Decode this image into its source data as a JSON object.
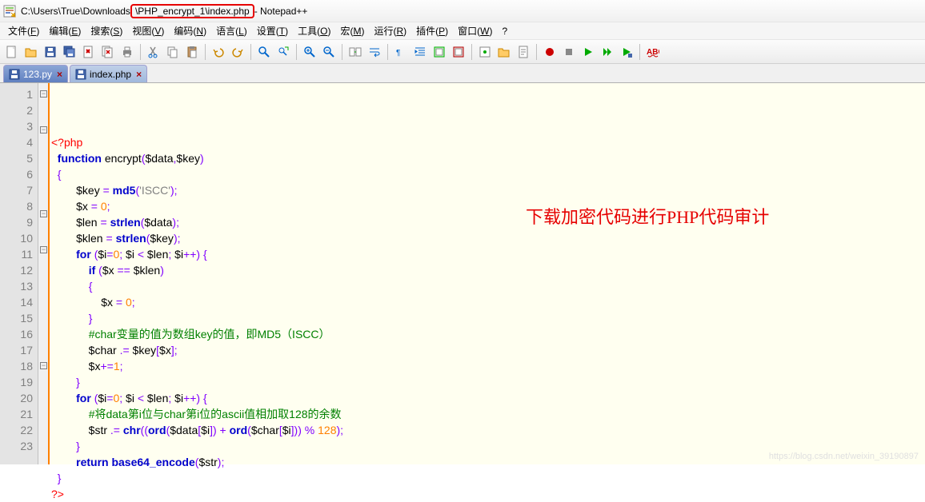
{
  "title": {
    "prefix": "C:\\Users\\True\\Downloads",
    "highlighted": "\\PHP_encrypt_1\\index.php",
    "suffix": " - Notepad++"
  },
  "menu": {
    "items": [
      "文件(F)",
      "编辑(E)",
      "搜索(S)",
      "视图(V)",
      "编码(N)",
      "语言(L)",
      "设置(T)",
      "工具(O)",
      "宏(M)",
      "运行(R)",
      "插件(P)",
      "窗口(W)",
      "?"
    ]
  },
  "tabs": {
    "items": [
      {
        "label": "123.py",
        "active": false
      },
      {
        "label": "index.php",
        "active": true
      }
    ]
  },
  "gutter": {
    "lines": [
      "1",
      "2",
      "3",
      "4",
      "5",
      "6",
      "7",
      "8",
      "9",
      "10",
      "11",
      "12",
      "13",
      "14",
      "15",
      "16",
      "17",
      "18",
      "19",
      "20",
      "21",
      "22",
      "23"
    ]
  },
  "code": {
    "lines": [
      [
        {
          "t": "<?php",
          "c": "tag"
        }
      ],
      [
        {
          "t": "  "
        },
        {
          "t": "function",
          "c": "kw"
        },
        {
          "t": " encrypt"
        },
        {
          "t": "(",
          "c": "pn"
        },
        {
          "t": "$data"
        },
        {
          "t": ",",
          "c": "pn"
        },
        {
          "t": "$key"
        },
        {
          "t": ")",
          "c": "pn"
        }
      ],
      [
        {
          "t": "  "
        },
        {
          "t": "{",
          "c": "pn"
        }
      ],
      [
        {
          "t": "        $key "
        },
        {
          "t": "=",
          "c": "op"
        },
        {
          "t": " "
        },
        {
          "t": "md5",
          "c": "fn"
        },
        {
          "t": "(",
          "c": "pn"
        },
        {
          "t": "'ISCC'",
          "c": "str"
        },
        {
          "t": ")",
          "c": "pn"
        },
        {
          "t": ";",
          "c": "pn"
        }
      ],
      [
        {
          "t": "        $x "
        },
        {
          "t": "=",
          "c": "op"
        },
        {
          "t": " "
        },
        {
          "t": "0",
          "c": "num"
        },
        {
          "t": ";",
          "c": "pn"
        }
      ],
      [
        {
          "t": "        $len "
        },
        {
          "t": "=",
          "c": "op"
        },
        {
          "t": " "
        },
        {
          "t": "strlen",
          "c": "fn"
        },
        {
          "t": "(",
          "c": "pn"
        },
        {
          "t": "$data"
        },
        {
          "t": ")",
          "c": "pn"
        },
        {
          "t": ";",
          "c": "pn"
        }
      ],
      [
        {
          "t": "        $klen "
        },
        {
          "t": "=",
          "c": "op"
        },
        {
          "t": " "
        },
        {
          "t": "strlen",
          "c": "fn"
        },
        {
          "t": "(",
          "c": "pn"
        },
        {
          "t": "$key"
        },
        {
          "t": ")",
          "c": "pn"
        },
        {
          "t": ";",
          "c": "pn"
        }
      ],
      [
        {
          "t": "        "
        },
        {
          "t": "for",
          "c": "kw"
        },
        {
          "t": " "
        },
        {
          "t": "(",
          "c": "pn"
        },
        {
          "t": "$i"
        },
        {
          "t": "=",
          "c": "op"
        },
        {
          "t": "0",
          "c": "num"
        },
        {
          "t": ";",
          "c": "pn"
        },
        {
          "t": " $i "
        },
        {
          "t": "<",
          "c": "op"
        },
        {
          "t": " $len"
        },
        {
          "t": ";",
          "c": "pn"
        },
        {
          "t": " $i"
        },
        {
          "t": "++",
          "c": "op"
        },
        {
          "t": ")",
          "c": "pn"
        },
        {
          "t": " "
        },
        {
          "t": "{",
          "c": "pn"
        }
      ],
      [
        {
          "t": "            "
        },
        {
          "t": "if",
          "c": "kw"
        },
        {
          "t": " "
        },
        {
          "t": "(",
          "c": "pn"
        },
        {
          "t": "$x "
        },
        {
          "t": "==",
          "c": "op"
        },
        {
          "t": " $klen"
        },
        {
          "t": ")",
          "c": "pn"
        }
      ],
      [
        {
          "t": "            "
        },
        {
          "t": "{",
          "c": "pn"
        }
      ],
      [
        {
          "t": "                $x "
        },
        {
          "t": "=",
          "c": "op"
        },
        {
          "t": " "
        },
        {
          "t": "0",
          "c": "num"
        },
        {
          "t": ";",
          "c": "pn"
        }
      ],
      [
        {
          "t": "            "
        },
        {
          "t": "}",
          "c": "pn"
        }
      ],
      [
        {
          "t": "            "
        },
        {
          "t": "#char变量的值为数组key的值，即MD5（ISCC）",
          "c": "cmt"
        }
      ],
      [
        {
          "t": "            $char "
        },
        {
          "t": ".=",
          "c": "op"
        },
        {
          "t": " $key"
        },
        {
          "t": "[",
          "c": "pn"
        },
        {
          "t": "$x"
        },
        {
          "t": "]",
          "c": "pn"
        },
        {
          "t": ";",
          "c": "pn"
        }
      ],
      [
        {
          "t": "            $x"
        },
        {
          "t": "+=",
          "c": "op"
        },
        {
          "t": "1",
          "c": "num"
        },
        {
          "t": ";",
          "c": "pn"
        }
      ],
      [
        {
          "t": "        "
        },
        {
          "t": "}",
          "c": "pn"
        }
      ],
      [
        {
          "t": "        "
        },
        {
          "t": "for",
          "c": "kw"
        },
        {
          "t": " "
        },
        {
          "t": "(",
          "c": "pn"
        },
        {
          "t": "$i"
        },
        {
          "t": "=",
          "c": "op"
        },
        {
          "t": "0",
          "c": "num"
        },
        {
          "t": ";",
          "c": "pn"
        },
        {
          "t": " $i "
        },
        {
          "t": "<",
          "c": "op"
        },
        {
          "t": " $len"
        },
        {
          "t": ";",
          "c": "pn"
        },
        {
          "t": " $i"
        },
        {
          "t": "++",
          "c": "op"
        },
        {
          "t": ")",
          "c": "pn"
        },
        {
          "t": " "
        },
        {
          "t": "{",
          "c": "pn"
        }
      ],
      [
        {
          "t": "            "
        },
        {
          "t": "#将data第i位与char第i位的ascii值相加取128的余数",
          "c": "cmt"
        }
      ],
      [
        {
          "t": "            $str "
        },
        {
          "t": ".=",
          "c": "op"
        },
        {
          "t": " "
        },
        {
          "t": "chr",
          "c": "fn"
        },
        {
          "t": "((",
          "c": "pn"
        },
        {
          "t": "ord",
          "c": "fn"
        },
        {
          "t": "(",
          "c": "pn"
        },
        {
          "t": "$data"
        },
        {
          "t": "[",
          "c": "pn"
        },
        {
          "t": "$i"
        },
        {
          "t": "])",
          "c": "pn"
        },
        {
          "t": " "
        },
        {
          "t": "+",
          "c": "op"
        },
        {
          "t": " "
        },
        {
          "t": "ord",
          "c": "fn"
        },
        {
          "t": "(",
          "c": "pn"
        },
        {
          "t": "$char"
        },
        {
          "t": "[",
          "c": "pn"
        },
        {
          "t": "$i"
        },
        {
          "t": "]))",
          "c": "pn"
        },
        {
          "t": " "
        },
        {
          "t": "%",
          "c": "op"
        },
        {
          "t": " "
        },
        {
          "t": "128",
          "c": "num"
        },
        {
          "t": ")",
          "c": "pn"
        },
        {
          "t": ";",
          "c": "pn"
        }
      ],
      [
        {
          "t": "        "
        },
        {
          "t": "}",
          "c": "pn"
        }
      ],
      [
        {
          "t": "        "
        },
        {
          "t": "return",
          "c": "kw"
        },
        {
          "t": " "
        },
        {
          "t": "base64_encode",
          "c": "fn"
        },
        {
          "t": "(",
          "c": "pn"
        },
        {
          "t": "$str"
        },
        {
          "t": ")",
          "c": "pn"
        },
        {
          "t": ";",
          "c": "pn"
        }
      ],
      [
        {
          "t": "  "
        },
        {
          "t": "}",
          "c": "pn"
        }
      ],
      [
        {
          "t": "?>",
          "c": "tag"
        }
      ]
    ]
  },
  "fold": {
    "marks": [
      "box",
      "",
      "box",
      "",
      "",
      "",
      "",
      "box",
      "",
      "box",
      "",
      "",
      "",
      "",
      "",
      "",
      "box",
      "",
      "",
      "",
      "",
      "",
      ""
    ]
  },
  "annotation": "下载加密代码进行PHP代码审计",
  "watermark": "https://blog.csdn.net/weixin_39190897",
  "toolbar_icons": [
    "new-file",
    "open-file",
    "save",
    "save-all",
    "close",
    "close-all",
    "print",
    "",
    "cut",
    "copy",
    "paste",
    "",
    "undo",
    "redo",
    "",
    "find",
    "replace",
    "",
    "zoom-in",
    "zoom-out",
    "",
    "sync",
    "word-wrap",
    "",
    "show-all",
    "indent",
    "fold",
    "unfold",
    "",
    "hidden-chars",
    "folder",
    "doc",
    "",
    "record",
    "stop",
    "play",
    "play-multi",
    "play-saved",
    "",
    "spellcheck"
  ]
}
